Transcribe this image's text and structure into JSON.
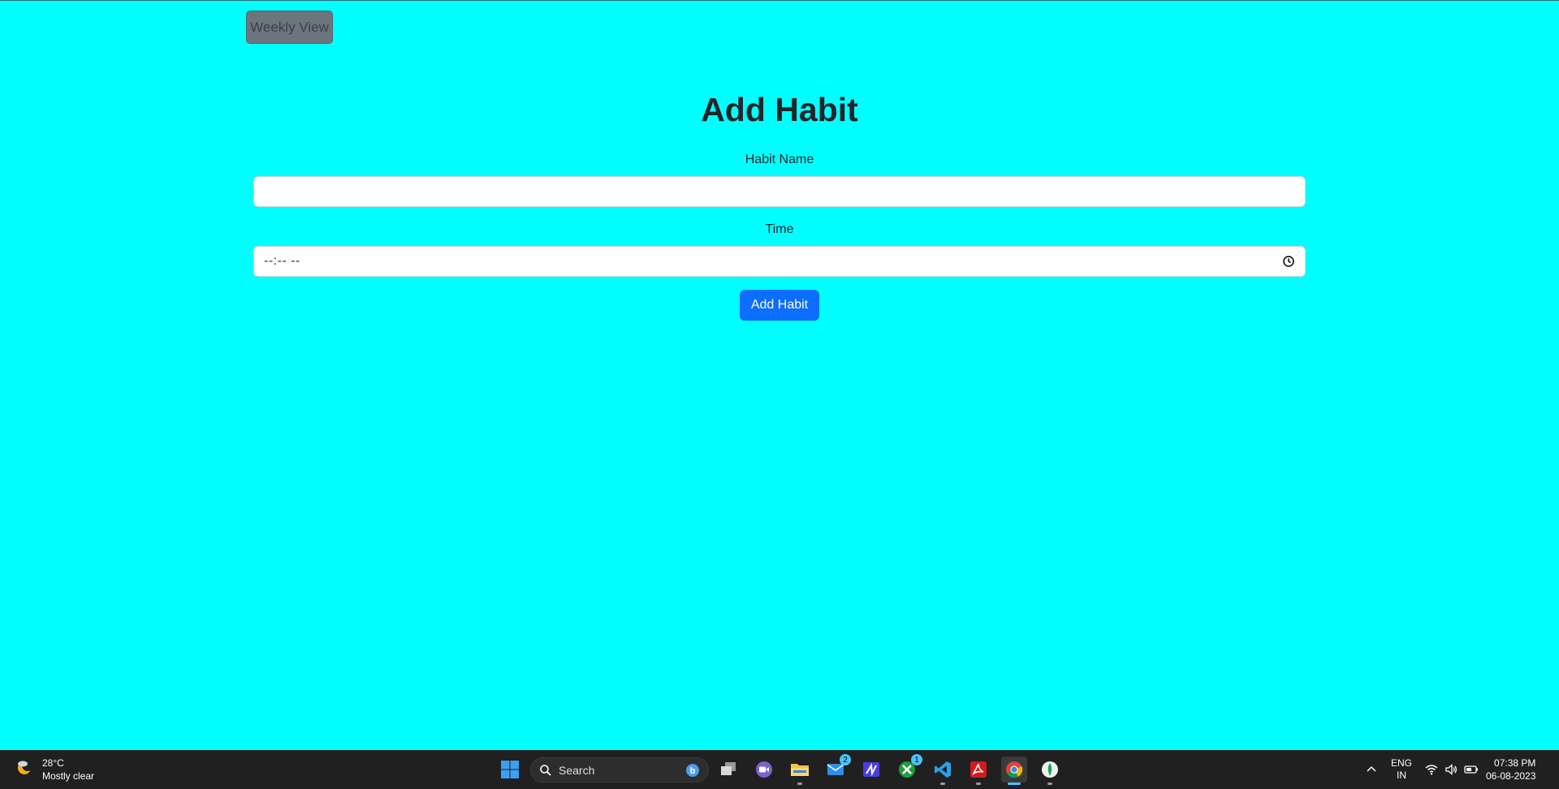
{
  "page": {
    "weekly_view_label": "Weekly View",
    "title": "Add Habit",
    "habit_name_label": "Habit Name",
    "habit_name_value": "",
    "time_label": "Time",
    "time_value": "--:-- --",
    "submit_label": "Add Habit"
  },
  "colors": {
    "background": "#00ffff",
    "primary": "#0d6efd",
    "secondary": "#6c757d"
  },
  "taskbar": {
    "weather": {
      "temp": "28°C",
      "condition": "Mostly clear",
      "icon": "moon-cloud-icon"
    },
    "search_placeholder": "Search",
    "apps": [
      {
        "name": "start-icon"
      },
      {
        "name": "task-view-icon"
      },
      {
        "name": "teams-icon"
      },
      {
        "name": "file-explorer-icon"
      },
      {
        "name": "mail-icon",
        "badge": "2"
      },
      {
        "name": "editor-icon"
      },
      {
        "name": "xbox-icon",
        "badge": "1"
      },
      {
        "name": "vscode-icon"
      },
      {
        "name": "acrobat-icon"
      },
      {
        "name": "chrome-icon"
      },
      {
        "name": "mongodb-compass-icon"
      }
    ],
    "lang_top": "ENG",
    "lang_bottom": "IN",
    "time": "07:38 PM",
    "date": "06-08-2023"
  }
}
